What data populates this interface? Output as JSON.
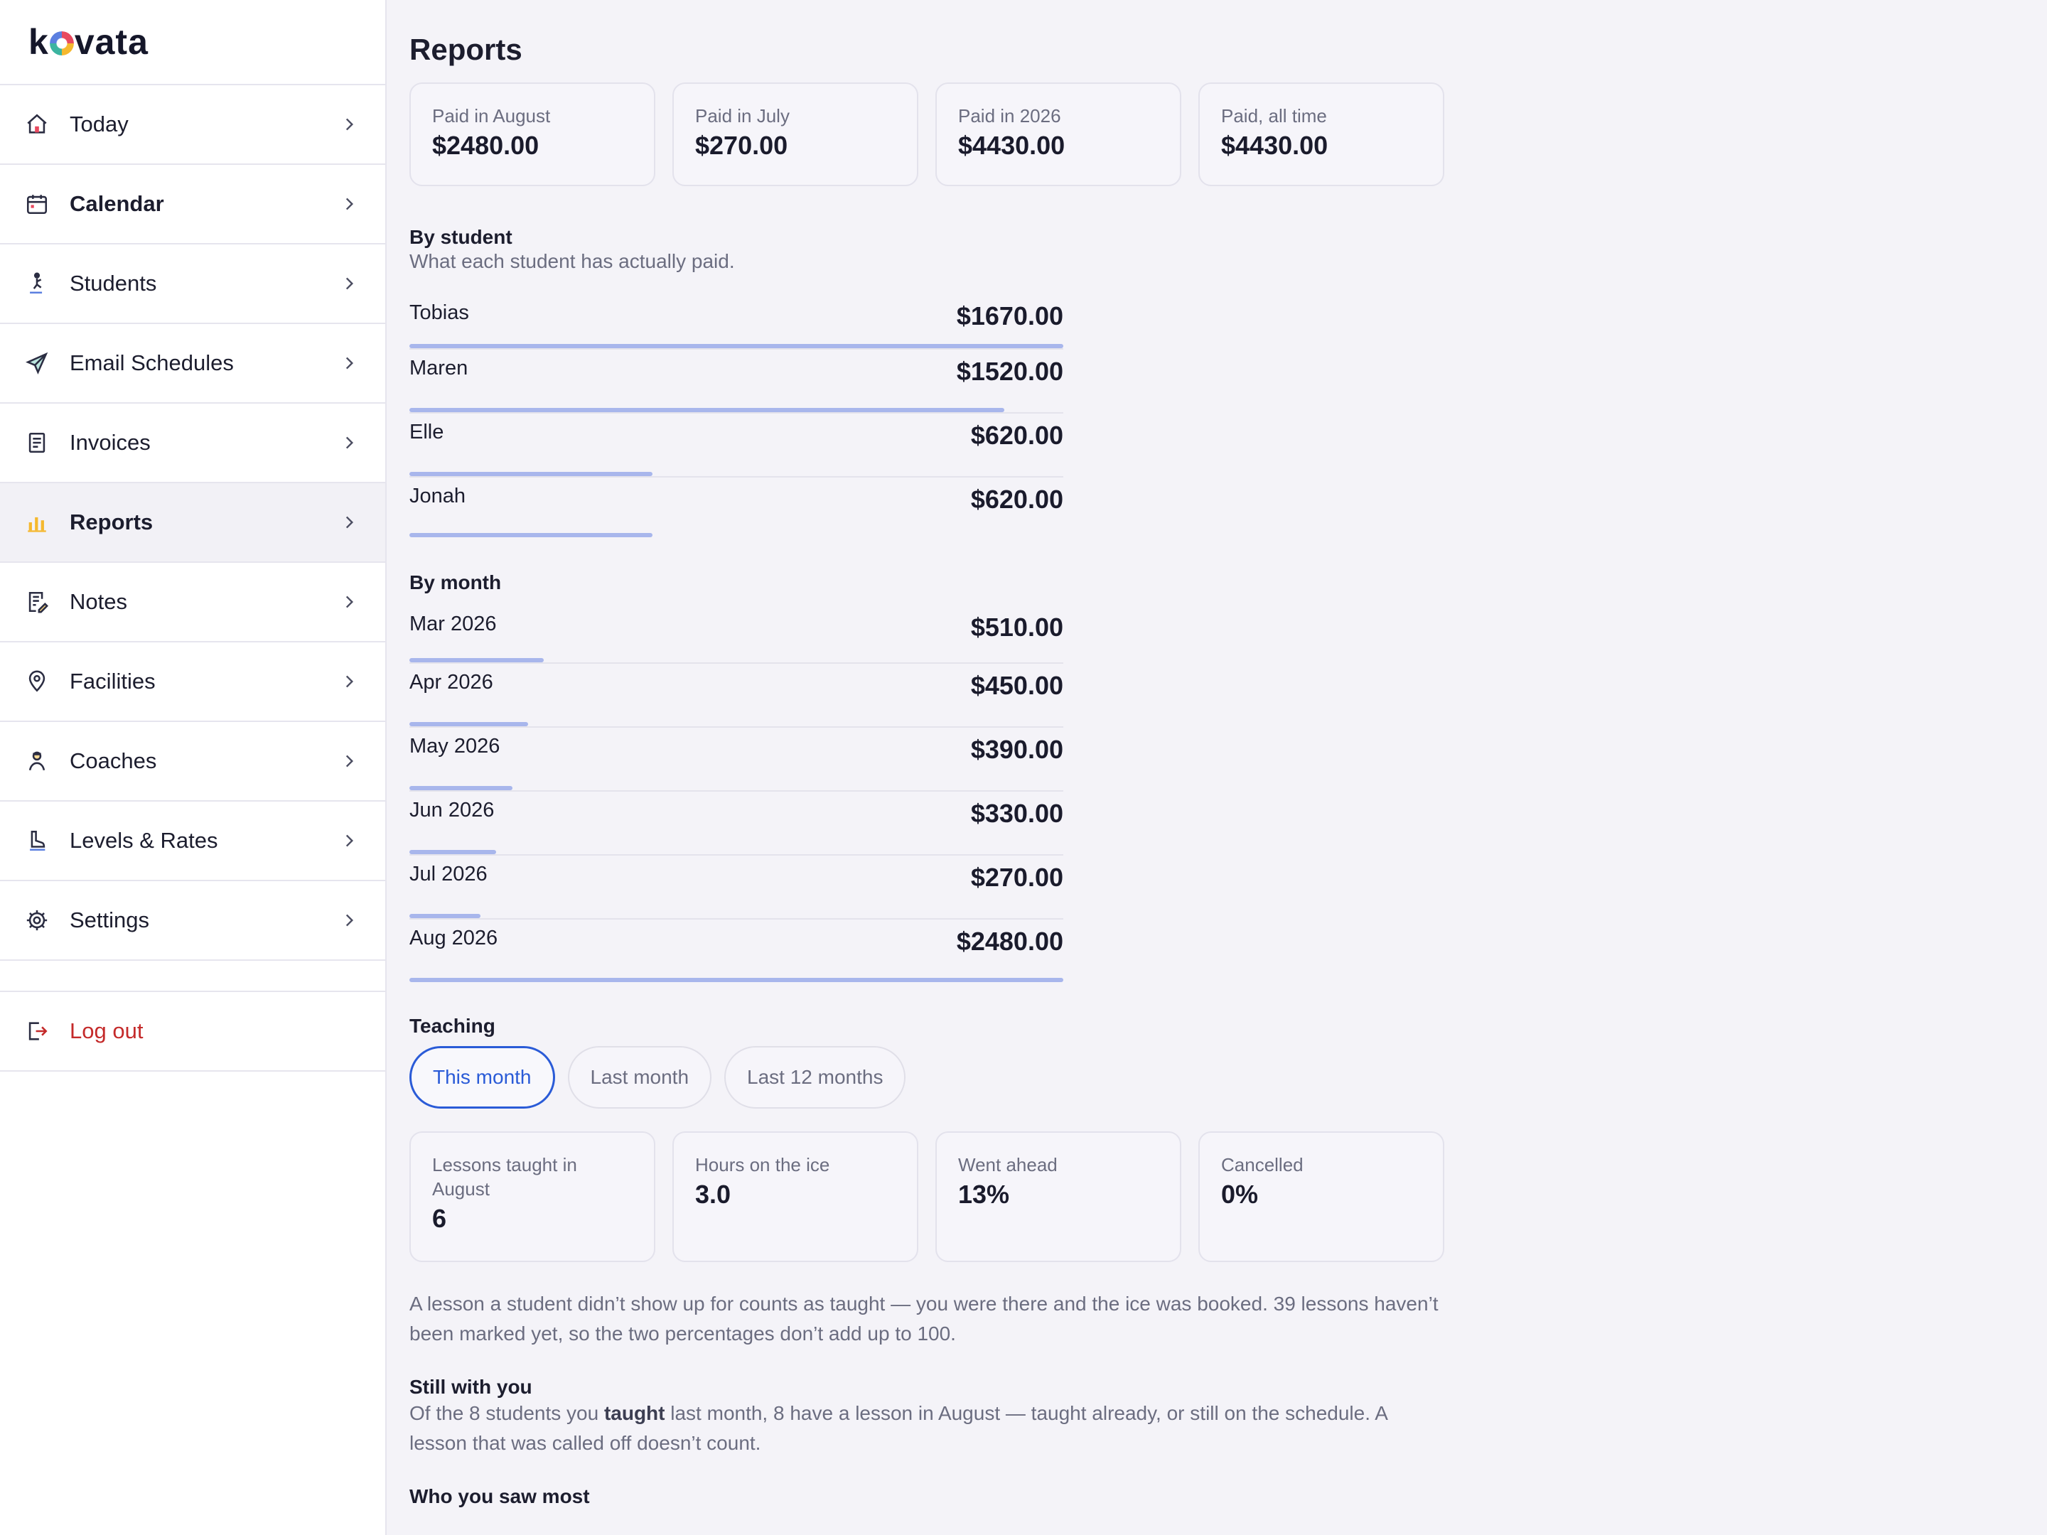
{
  "app": {
    "logo_pre": "k",
    "logo_post": "vata"
  },
  "sidebar": {
    "items": [
      {
        "label": "Today"
      },
      {
        "label": "Calendar"
      },
      {
        "label": "Students"
      },
      {
        "label": "Email Schedules"
      },
      {
        "label": "Invoices"
      },
      {
        "label": "Reports"
      },
      {
        "label": "Notes"
      },
      {
        "label": "Facilities"
      },
      {
        "label": "Coaches"
      },
      {
        "label": "Levels & Rates"
      },
      {
        "label": "Settings"
      }
    ],
    "logout": "Log out"
  },
  "page": {
    "title": "Reports"
  },
  "summary": [
    {
      "label": "Paid in August",
      "value": "$2480.00"
    },
    {
      "label": "Paid in July",
      "value": "$270.00"
    },
    {
      "label": "Paid in 2026",
      "value": "$4430.00"
    },
    {
      "label": "Paid, all time",
      "value": "$4430.00"
    }
  ],
  "by_student": {
    "title": "By student",
    "subtitle": "What each student has actually paid.",
    "rows": [
      {
        "name": "Tobias",
        "amount": "$1670.00",
        "value": 1670
      },
      {
        "name": "Maren",
        "amount": "$1520.00",
        "value": 1520
      },
      {
        "name": "Elle",
        "amount": "$620.00",
        "value": 620
      },
      {
        "name": "Jonah",
        "amount": "$620.00",
        "value": 620
      }
    ]
  },
  "by_month": {
    "title": "By month",
    "rows": [
      {
        "name": "Mar 2026",
        "amount": "$510.00",
        "value": 510
      },
      {
        "name": "Apr 2026",
        "amount": "$450.00",
        "value": 450
      },
      {
        "name": "May 2026",
        "amount": "$390.00",
        "value": 390
      },
      {
        "name": "Jun 2026",
        "amount": "$330.00",
        "value": 330
      },
      {
        "name": "Jul 2026",
        "amount": "$270.00",
        "value": 270
      },
      {
        "name": "Aug 2026",
        "amount": "$2480.00",
        "value": 2480
      }
    ]
  },
  "teaching": {
    "title": "Teaching",
    "tabs": [
      "This month",
      "Last month",
      "Last 12 months"
    ],
    "active_tab": "This month",
    "stats": [
      {
        "label": "Lessons taught in August",
        "value": "6"
      },
      {
        "label": "Hours on the ice",
        "value": "3.0"
      },
      {
        "label": "Went ahead",
        "value": "13%"
      },
      {
        "label": "Cancelled",
        "value": "0%"
      }
    ],
    "note": "A lesson a student didn’t show up for counts as taught — you were there and the ice was booked. 39 lessons haven’t been marked yet, so the two percentages don’t add up to 100."
  },
  "still_with_you": {
    "title": "Still with you",
    "text_pre": "Of the 8 students you ",
    "text_bold": "taught",
    "text_post": " last month, 8 have a lesson in August — taught already, or still on the schedule. A lesson that was called off doesn’t count."
  },
  "who_you_saw_most": {
    "title": "Who you saw most"
  },
  "colors": {
    "accent": "#2a5bd7",
    "bar": "#a8b6ec",
    "logout": "#c42a2a"
  }
}
